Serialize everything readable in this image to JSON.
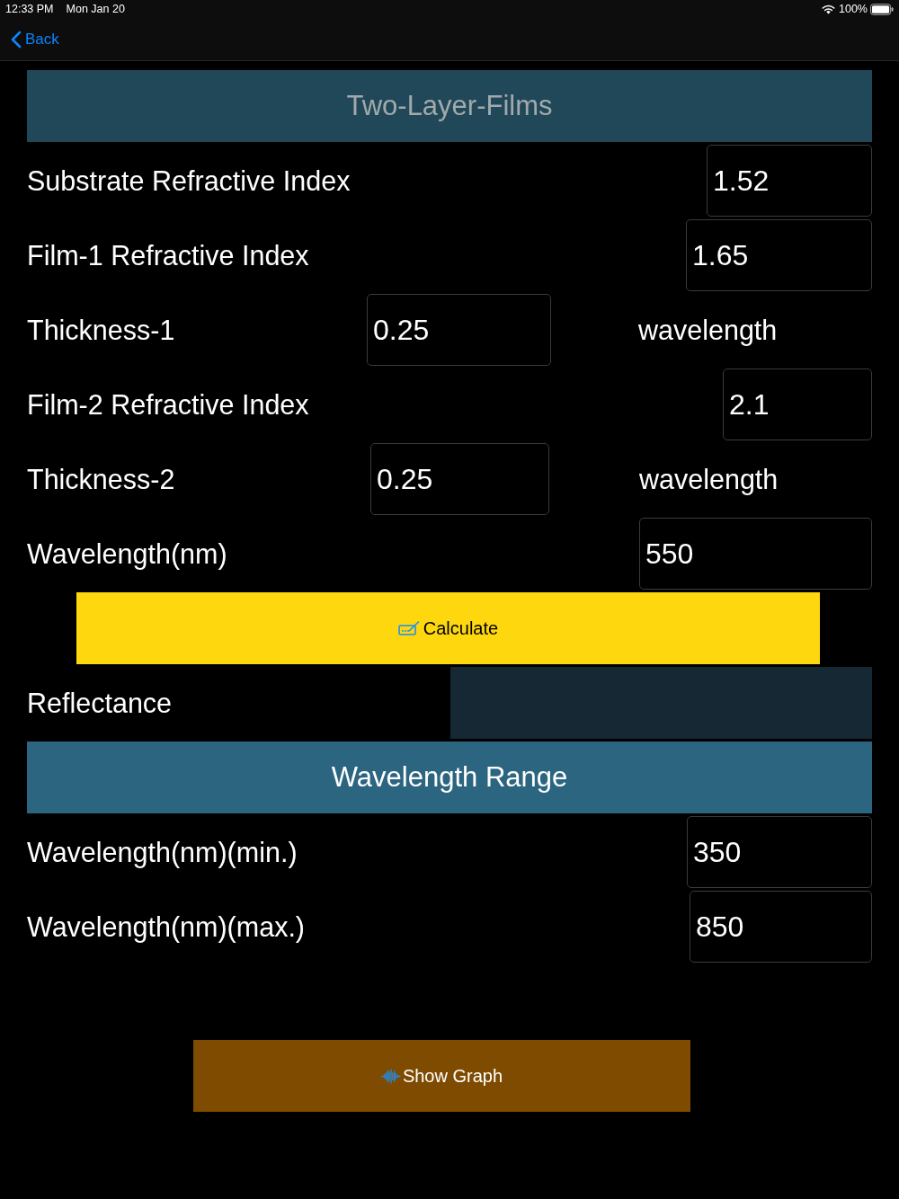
{
  "status_bar": {
    "time": "12:33 PM",
    "date": "Mon Jan 20",
    "battery": "100%"
  },
  "nav": {
    "back": "Back"
  },
  "title": "Two-Layer-Films",
  "rows": [
    {
      "kind": "field",
      "label": "Substrate Refractive Index",
      "value": "1.52"
    },
    {
      "kind": "field",
      "label": "Film-1 Refractive Index",
      "value": "1.65"
    },
    {
      "kind": "thickness",
      "label": "Thickness-1",
      "value": "0.25",
      "unit": "wavelength"
    },
    {
      "kind": "field",
      "label": "Film-2 Refractive Index",
      "value": "2.1"
    },
    {
      "kind": "thickness",
      "label": "Thickness-2",
      "value": "0.25",
      "unit": "wavelength"
    },
    {
      "kind": "field",
      "label": "Wavelength(nm)",
      "value": "550"
    }
  ],
  "calculate": {
    "label": "Calculate"
  },
  "result": {
    "label": "Reflectance"
  },
  "range": {
    "title": "Wavelength Range",
    "rows": [
      {
        "label": "Wavelength(nm)(min.)",
        "value": "350"
      },
      {
        "label": "Wavelength(nm)(max.)",
        "value": "850"
      }
    ]
  },
  "graph_button": {
    "label": "Show Graph"
  }
}
